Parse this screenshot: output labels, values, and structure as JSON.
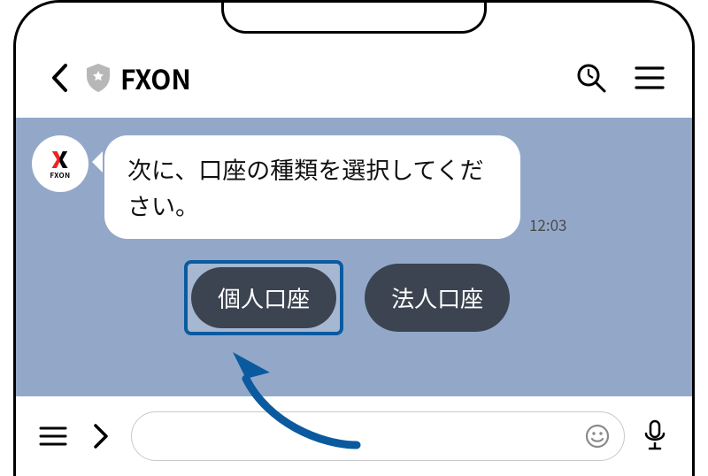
{
  "header": {
    "title": "FXON"
  },
  "avatar": {
    "logo_text": "FXON"
  },
  "message": {
    "text": "次に、口座の種類を選択してください。",
    "timestamp": "12:03"
  },
  "options": {
    "personal": "個人口座",
    "corporate": "法人口座"
  },
  "input": {
    "placeholder": ""
  }
}
